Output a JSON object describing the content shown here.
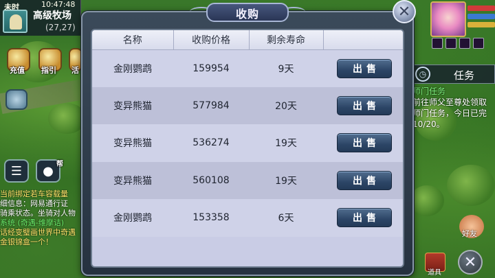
{
  "hud": {
    "time_state": "未时",
    "clock": "10:47:48",
    "location": "高级牧场",
    "coords": "(27,27)",
    "buttons": [
      {
        "label": "充值",
        "icon": "coin-icon"
      },
      {
        "label": "指引",
        "icon": "guide-icon"
      },
      {
        "label": "活",
        "icon": "activity-icon"
      }
    ],
    "voice_label": "帮",
    "chat_lines": [
      {
        "text": "当前绑定若车容载量",
        "color": "#ffe36a"
      },
      {
        "text": "细信息：网易通行证",
        "color": "#ffffff"
      },
      {
        "text": "骑乘状态。坐骑对人物",
        "color": "#ffffff"
      },
      {
        "text": "系统 (奇遇-维摩诘)",
        "color": "#6cf06c"
      },
      {
        "text": "话经变璧画世界中奇遇",
        "color": "#ffe36a"
      },
      {
        "text": "金银锦盒一个！",
        "color": "#ffe36a"
      }
    ]
  },
  "right_hud": {
    "task_label": "任务",
    "task_lines": [
      {
        "text": "师门任务",
        "color": "#7df27d"
      },
      {
        "text": "前往师父至尊处领取",
        "color": "#ffffff"
      },
      {
        "text": "师门任务，今日已完",
        "color": "#ffffff"
      },
      {
        "text": "10/20。",
        "color": "#ffffff"
      }
    ],
    "friend_label": "好友",
    "bag_label": "道具"
  },
  "dialog": {
    "title": "收购",
    "columns": [
      "名称",
      "收购价格",
      "剩余寿命",
      ""
    ],
    "rows": [
      {
        "name": "金刚鹦鹉",
        "price": "159954",
        "life": "9天",
        "action": "出售"
      },
      {
        "name": "变异熊猫",
        "price": "577984",
        "life": "20天",
        "action": "出售"
      },
      {
        "name": "变异熊猫",
        "price": "536274",
        "life": "19天",
        "action": "出售"
      },
      {
        "name": "变异熊猫",
        "price": "560108",
        "life": "19天",
        "action": "出售"
      },
      {
        "name": "金刚鹦鹉",
        "price": "153358",
        "life": "6天",
        "action": "出售"
      }
    ]
  },
  "colors": {
    "dialog_frame": "#263240",
    "table_bg": "#c9cce5",
    "sell_button": "#2c4566",
    "hp_bar": "#d23a3a",
    "mp_bar": "#3a7ad2"
  }
}
